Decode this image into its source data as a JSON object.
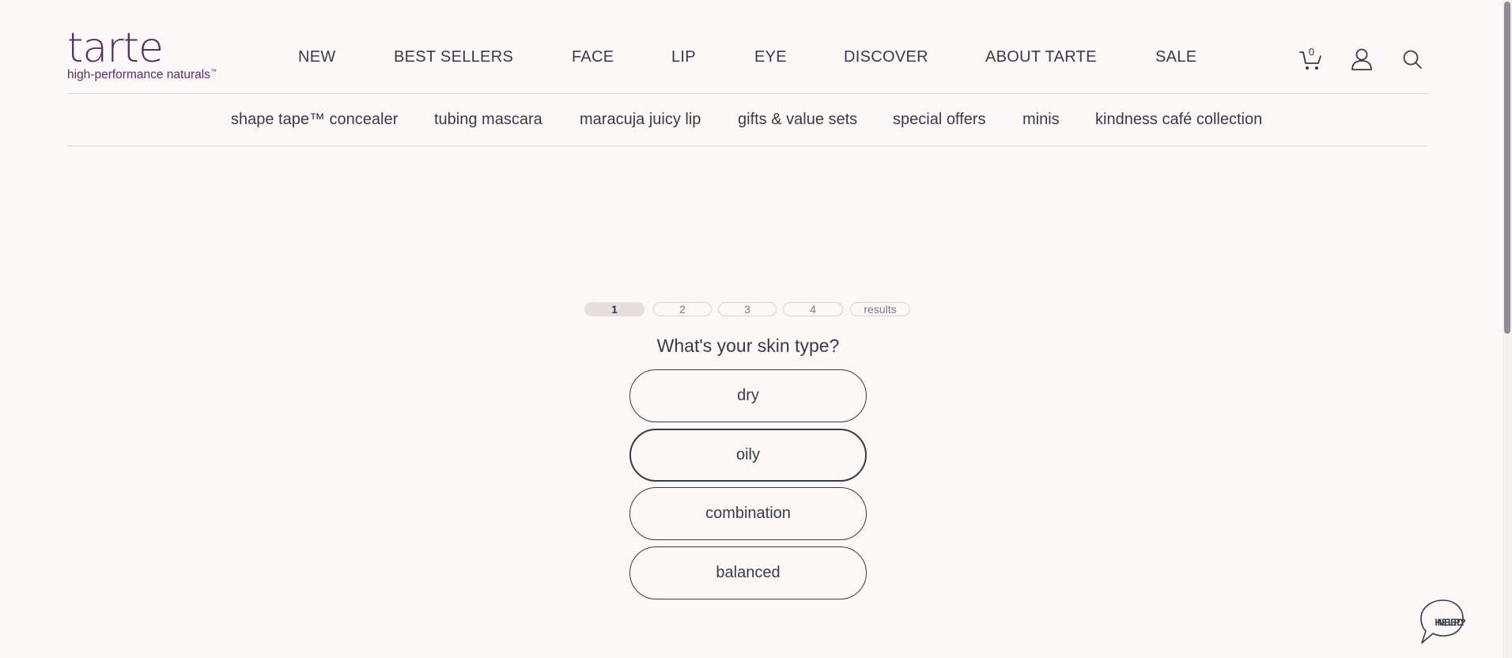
{
  "brand": {
    "logo_word": "tarte",
    "logo_tagline": "high-performance naturals",
    "logo_tm": "™",
    "color": "#5a2d6b"
  },
  "main_nav": [
    "NEW",
    "BEST SELLERS",
    "FACE",
    "LIP",
    "EYE",
    "DISCOVER",
    "ABOUT TARTE",
    "SALE"
  ],
  "header_icons": {
    "cart": {
      "icon": "cart-icon",
      "count": "0"
    },
    "account": {
      "icon": "user-icon"
    },
    "search": {
      "icon": "search-icon"
    }
  },
  "sub_nav": [
    "shape tape™ concealer",
    "tubing mascara",
    "maracuja juicy lip",
    "gifts & value sets",
    "special offers",
    "minis",
    "kindness café collection"
  ],
  "quiz": {
    "steps": [
      "1",
      "2",
      "3",
      "4",
      "results"
    ],
    "active_step": "1",
    "question": "What's your skin type?",
    "options": [
      "dry",
      "oily",
      "combination",
      "balanced"
    ],
    "selected_option": "oily"
  },
  "help": {
    "label_line1": "NEED",
    "label_line2": "HELP?"
  }
}
